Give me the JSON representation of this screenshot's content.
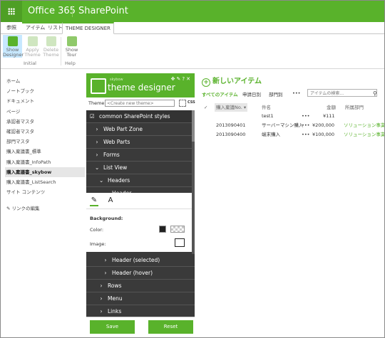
{
  "suite": {
    "brand": "Office 365",
    "app": "SharePoint"
  },
  "ribbon": {
    "tabs": [
      "参照",
      "アイテム",
      "リスト",
      "THEME DESIGNER"
    ],
    "buttons": [
      {
        "label": "Show Designer"
      },
      {
        "label": "Apply Theme"
      },
      {
        "label": "Delete Theme"
      },
      {
        "label": "Show Tour"
      }
    ],
    "groups": [
      "Initial",
      "Help"
    ]
  },
  "leftnav": {
    "items": [
      "ホーム",
      "ノートブック",
      "ドキュメント",
      "ページ",
      "承認者マスタ",
      "確認者マスタ",
      "部門マスタ",
      "購入稟議書_標準",
      "購入稟議書_InfoPath",
      "購入稟議書_skybow",
      "購入稟議書_ListSearch",
      "サイト コンテンツ"
    ],
    "selected_index": 9,
    "edit_links": "リンクの編集"
  },
  "theme_designer": {
    "subtitle": "skybow",
    "title": "theme designer",
    "theme_label": "Theme",
    "theme_placeholder": "<Create new theme>",
    "css": "CSS",
    "top_item": "common SharePoint styles",
    "items": [
      {
        "label": "Web Part Zone",
        "indent": 1,
        "state": "collapsed"
      },
      {
        "label": "Web Parts",
        "indent": 1,
        "state": "collapsed"
      },
      {
        "label": "Forms",
        "indent": 1,
        "state": "collapsed"
      },
      {
        "label": "List View",
        "indent": 1,
        "state": "expanded"
      },
      {
        "label": "Headers",
        "indent": 2,
        "state": "expanded"
      },
      {
        "label": "Header",
        "indent": 3,
        "state": "expanded"
      }
    ],
    "editor": {
      "background_label": "Background:",
      "color_label": "Color:",
      "image_label": "Image:"
    },
    "items_after": [
      {
        "label": "Header (selected)",
        "indent": 3,
        "state": "collapsed"
      },
      {
        "label": "Header (hover)",
        "indent": 3,
        "state": "collapsed"
      },
      {
        "label": "Rows",
        "indent": 2,
        "state": "collapsed"
      },
      {
        "label": "Menu",
        "indent": 2,
        "state": "collapsed"
      },
      {
        "label": "Links",
        "indent": 2,
        "state": "collapsed"
      }
    ],
    "save": "Save",
    "reset": "Reset"
  },
  "content": {
    "new_item": "新しいアイテム",
    "views": [
      "すべてのアイテム",
      "申請日別",
      "部門別"
    ],
    "more": "•••",
    "search_placeholder": "アイテムの検索...",
    "columns": [
      "購入稟議No.",
      "件名",
      "金額",
      "所属部門"
    ],
    "rows": [
      {
        "no": "",
        "subject": "test1",
        "amount": "¥111",
        "dept": ""
      },
      {
        "no": "2013090401",
        "subject": "サーバーマシン購入",
        "amount": "¥200,000",
        "dept": "ソリューション事業部"
      },
      {
        "no": "2013090400",
        "subject": "端末購入",
        "amount": "¥100,000",
        "dept": "ソリューション事業部"
      }
    ]
  },
  "colors": {
    "accent": "#59b22b",
    "panel": "#3a3a3a"
  }
}
